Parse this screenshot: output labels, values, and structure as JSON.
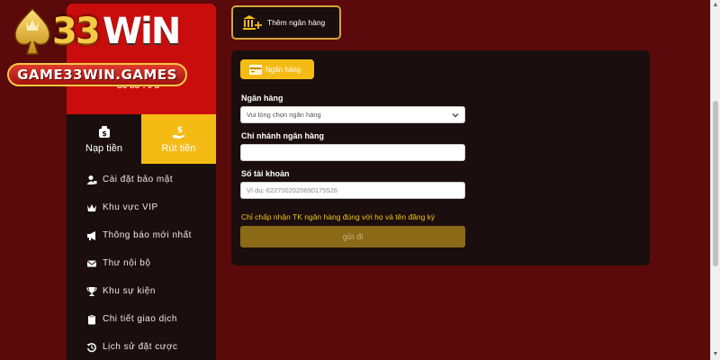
{
  "logo": {
    "brand_number": "33",
    "brand_word": "WiN",
    "domain": "GAME33WIN.GAMES"
  },
  "profile": {
    "balance_text": "Số dư : 0 đ"
  },
  "tabs": [
    {
      "label": "Nạp tiền",
      "icon": "deposit-dollar-icon",
      "active": false
    },
    {
      "label": "Rút tiền",
      "icon": "withdraw-hand-dollar-icon",
      "active": true
    }
  ],
  "menu": [
    {
      "label": "Cài đặt bảo mật",
      "icon": "user-lock-icon"
    },
    {
      "label": "Khu vực VIP",
      "icon": "crown-icon"
    },
    {
      "label": "Thông báo mới nhất",
      "icon": "megaphone-icon"
    },
    {
      "label": "Thư nội bộ",
      "icon": "envelope-icon"
    },
    {
      "label": "Khu sự kiện",
      "icon": "trophy-icon"
    },
    {
      "label": "Chi tiết giao dịch",
      "icon": "clipboard-icon"
    },
    {
      "label": "Lịch sử đặt cược",
      "icon": "history-icon"
    }
  ],
  "add_bank": {
    "label": "Thêm ngân hàng"
  },
  "form": {
    "chip_label": "Ngân hàng",
    "bank_label": "Ngân hàng",
    "bank_select_value": "Vui lòng chọn ngân hàng",
    "branch_label": "Chi nhánh ngân hàng",
    "branch_value": "",
    "account_label": "Số tài khoản",
    "account_placeholder": "Ví dụ: 6227002020690175526",
    "notice": "Chỉ chấp nhận TK ngân hàng đúng với họ và tên đăng ký",
    "submit_label": "gửi đi"
  },
  "colors": {
    "background": "#5a0a0a",
    "panel": "#1a0e0e",
    "accent_gold": "#f5bb15",
    "profile_red": "#c90d0d",
    "notice_yellow": "#f5c518"
  }
}
